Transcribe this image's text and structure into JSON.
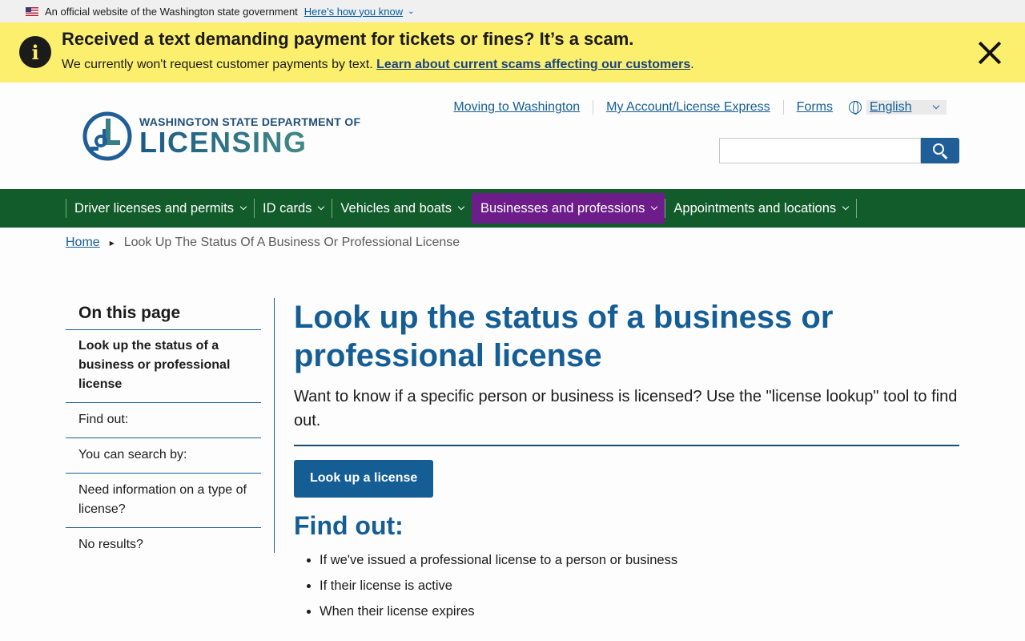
{
  "gov_banner": {
    "text": "An official website of the Washington state government",
    "link": "Here’s how you know"
  },
  "alert": {
    "icon": "info-icon",
    "title": "Received a text demanding payment for tickets or fines? It’s a scam.",
    "text": "We currently won't request customer payments by text. ",
    "link": "Learn about current scams affecting our customers",
    "suffix": "."
  },
  "logo": {
    "line1": "WASHINGTON STATE DEPARTMENT OF",
    "line2": "LICENSING",
    "mark": "dol-logo-mark"
  },
  "utility_links": [
    "Moving to Washington",
    "My Account/License Express",
    "Forms"
  ],
  "language": "English",
  "search": {
    "placeholder": "",
    "value": ""
  },
  "nav": [
    "Driver licenses and permits",
    "ID cards",
    "Vehicles and boats",
    "Businesses and professions",
    "Appointments and locations"
  ],
  "breadcrumb": {
    "home": "Home",
    "current": "Look Up The Status Of A Business Or Professional License"
  },
  "sidenav": {
    "heading": "On this page",
    "items": [
      "Look up the status of a business or professional license",
      "Find out:",
      "You can search by:",
      "Need information on a type of license?",
      "No results?"
    ]
  },
  "main": {
    "title": "Look up the status of a business or professional license",
    "lede": "Want to know if a specific person or business is licensed? Use the \"license lookup\" tool to find out.",
    "cta": "Look up a license",
    "find_out_heading": "Find out:",
    "find_out_items": [
      "If we've issued a professional license to a person or business",
      "If their license is active",
      "When their license expires"
    ]
  },
  "colors": {
    "alert_bg": "#fdef6e",
    "nav_bg": "#115c2a",
    "nav_active": "#6c1d8a",
    "brand_blue": "#155e95"
  }
}
